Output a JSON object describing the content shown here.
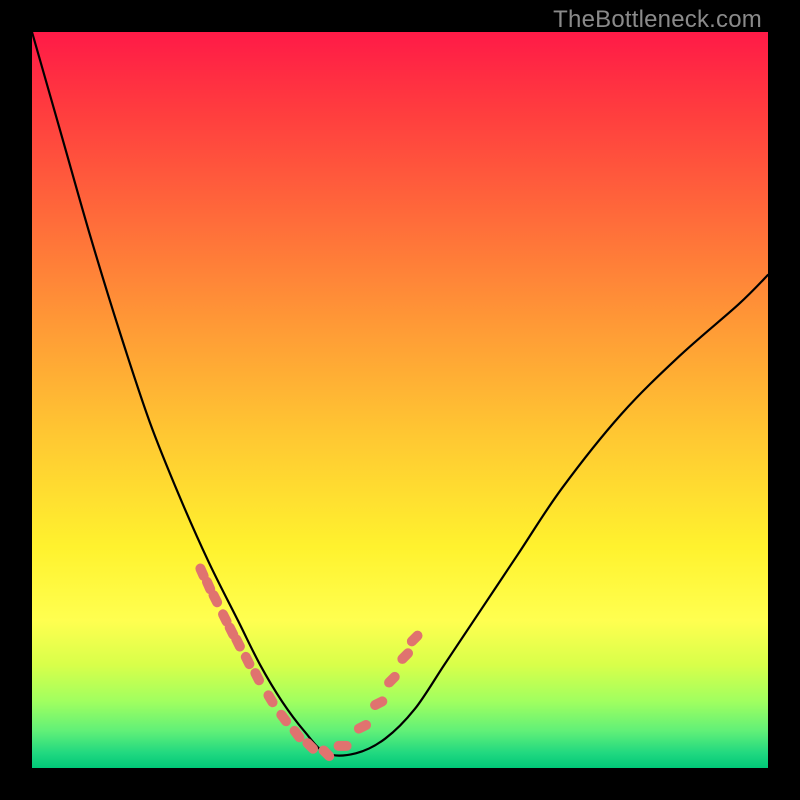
{
  "watermark": "TheBottleneck.com",
  "chart_data": {
    "type": "line",
    "title": "",
    "xlabel": "",
    "ylabel": "",
    "x": [
      0.0,
      0.04,
      0.08,
      0.12,
      0.16,
      0.2,
      0.24,
      0.28,
      0.31,
      0.34,
      0.37,
      0.4,
      0.44,
      0.48,
      0.52,
      0.56,
      0.6,
      0.66,
      0.72,
      0.8,
      0.88,
      0.96,
      1.0
    ],
    "values": [
      1.0,
      0.86,
      0.72,
      0.59,
      0.47,
      0.37,
      0.28,
      0.2,
      0.14,
      0.09,
      0.05,
      0.02,
      0.02,
      0.04,
      0.08,
      0.14,
      0.2,
      0.29,
      0.38,
      0.48,
      0.56,
      0.63,
      0.67
    ],
    "xlim": [
      0,
      1
    ],
    "ylim": [
      0,
      1
    ],
    "markers": {
      "x": [
        0.231,
        0.24,
        0.249,
        0.262,
        0.271,
        0.28,
        0.293,
        0.306,
        0.324,
        0.342,
        0.36,
        0.378,
        0.4,
        0.422,
        0.449,
        0.471,
        0.489,
        0.507,
        0.52
      ],
      "y": [
        0.266,
        0.248,
        0.23,
        0.204,
        0.186,
        0.17,
        0.146,
        0.124,
        0.094,
        0.068,
        0.046,
        0.03,
        0.02,
        0.03,
        0.056,
        0.088,
        0.12,
        0.152,
        0.176
      ]
    },
    "background_gradient": {
      "stops": [
        {
          "pos": 0.0,
          "color": "#ff1a47"
        },
        {
          "pos": 0.25,
          "color": "#ff6a3a"
        },
        {
          "pos": 0.55,
          "color": "#ffc832"
        },
        {
          "pos": 0.8,
          "color": "#ffff50"
        },
        {
          "pos": 1.0,
          "color": "#00c878"
        }
      ]
    }
  }
}
